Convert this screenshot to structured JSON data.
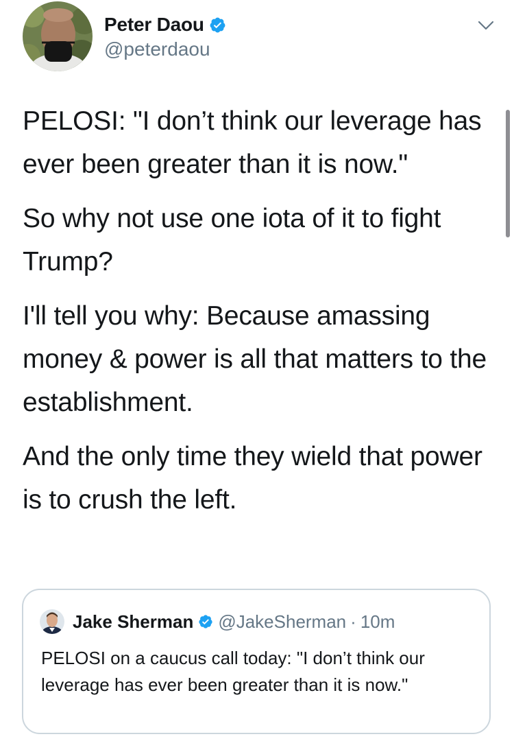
{
  "tweet": {
    "author": {
      "name": "Peter Daou",
      "handle": "@peterdaou",
      "verified": true
    },
    "paragraphs": [
      "PELOSI: \"I don’t think our leverage has ever been greater than it is now.\"",
      "So why not use one iota of it to fight Trump?",
      "I'll tell you why: Because amassing money & power is all that matters to the establishment.",
      "And the only time they wield that power is to crush the left."
    ]
  },
  "quoted_tweet": {
    "author": {
      "name": "Jake Sherman",
      "handle": "@JakeSherman",
      "verified": true
    },
    "separator": "·",
    "time": "10m",
    "text": "PELOSI on a caucus call today: \"I don’t think our leverage has ever been greater than it is now.\""
  },
  "icons": {
    "verified": "verified-badge-icon",
    "menu": "chevron-down-icon"
  },
  "colors": {
    "verified_blue": "#1da1f2",
    "secondary_text": "#657786",
    "border": "#ccd6dd",
    "text": "#14171a"
  }
}
